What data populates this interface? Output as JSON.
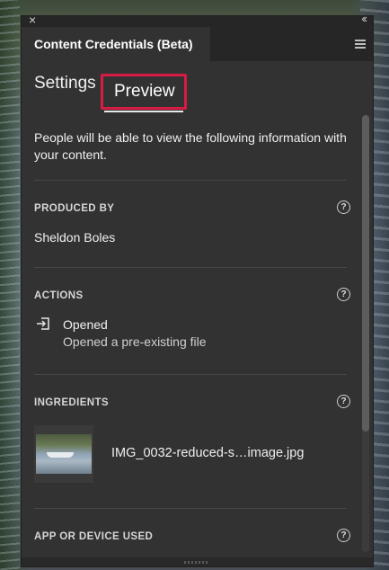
{
  "window": {
    "close_glyph": "×",
    "collapse_glyph": "‹‹"
  },
  "panel": {
    "title": "Content Credentials (Beta)"
  },
  "tabs": {
    "settings": "Settings",
    "preview": "Preview",
    "active": "preview",
    "highlight_color": "#d81b45"
  },
  "intro": "People will be able to view the following information with your content.",
  "sections": {
    "produced_by": {
      "title": "PRODUCED BY",
      "value": "Sheldon Boles"
    },
    "actions": {
      "title": "ACTIONS",
      "items": [
        {
          "icon": "open-file-icon",
          "name": "Opened",
          "description": "Opened a pre-existing file"
        }
      ]
    },
    "ingredients": {
      "title": "INGREDIENTS",
      "items": [
        {
          "name": "IMG_0032-reduced-s…image.jpg"
        }
      ]
    },
    "app_or_device": {
      "title": "APP OR DEVICE USED"
    }
  },
  "colors": {
    "panel_bg": "#323232",
    "header_bg": "#262626",
    "text": "#efefef"
  }
}
